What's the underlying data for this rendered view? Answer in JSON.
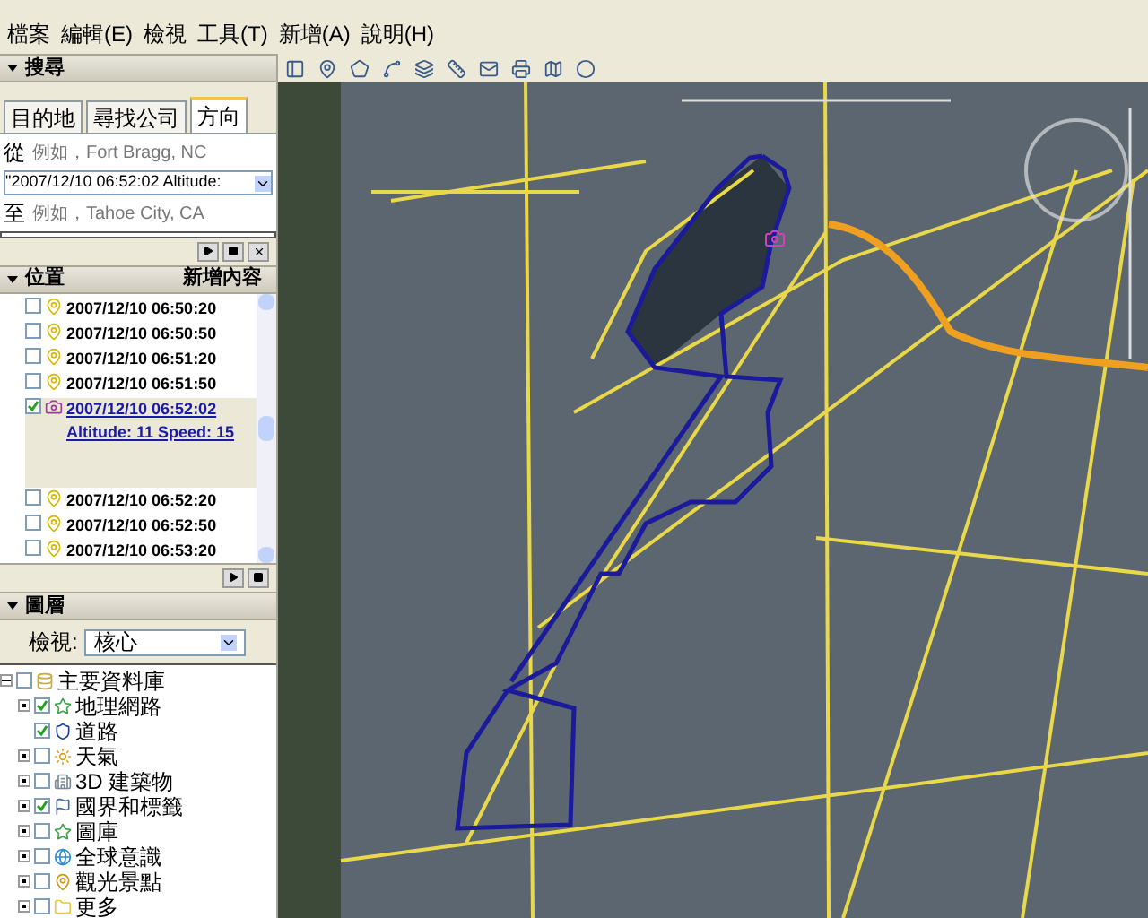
{
  "menu": [
    "檔案",
    "編輯(E)",
    "檢視",
    "工具(T)",
    "新增(A)",
    "說明(H)"
  ],
  "search": {
    "title": "搜尋",
    "tabs": [
      {
        "label": "目的地",
        "selected": false
      },
      {
        "label": "尋找公司",
        "selected": false
      },
      {
        "label": "方向",
        "selected": true
      }
    ],
    "from_label": "從",
    "from_placeholder": "例如，Fort Bragg, NC",
    "from_value": "\"2007/12/10 06:52:02 Altitude:",
    "to_label": "至",
    "to_placeholder": "例如，Tahoe City, CA"
  },
  "places": {
    "title": "位置",
    "add_button": "新增內容",
    "items": [
      {
        "label": "2007/12/10 06:50:20",
        "checked": false,
        "kind": "pin",
        "selected": false
      },
      {
        "label": "2007/12/10 06:50:50",
        "checked": false,
        "kind": "pin",
        "selected": false
      },
      {
        "label": "2007/12/10 06:51:20",
        "checked": false,
        "kind": "pin",
        "selected": false
      },
      {
        "label": "2007/12/10 06:51:50",
        "checked": false,
        "kind": "pin",
        "selected": false
      },
      {
        "label": "2007/12/10 06:52:02 Altitude: 11 Speed: 15",
        "checked": true,
        "kind": "camera",
        "selected": true
      },
      {
        "label": "2007/12/10 06:52:20",
        "checked": false,
        "kind": "pin",
        "selected": false
      },
      {
        "label": "2007/12/10 06:52:50",
        "checked": false,
        "kind": "pin",
        "selected": false
      },
      {
        "label": "2007/12/10 06:53:20",
        "checked": false,
        "kind": "pin",
        "selected": false
      }
    ]
  },
  "layers": {
    "title": "圖層",
    "view_label": "檢視:",
    "view_value": "核心",
    "tree": {
      "label": "主要資料庫",
      "checked": false,
      "expanded": true,
      "kind": "database",
      "children": [
        {
          "label": "地理網路",
          "checked": true,
          "expanded": false,
          "kind": "star"
        },
        {
          "label": "道路",
          "checked": true,
          "kind": "shield"
        },
        {
          "label": "天氣",
          "checked": false,
          "expanded": false,
          "kind": "sun"
        },
        {
          "label": "3D 建築物",
          "checked": false,
          "expanded": false,
          "kind": "building"
        },
        {
          "label": "國界和標籤",
          "checked": true,
          "expanded": false,
          "kind": "flag"
        },
        {
          "label": "圖庫",
          "checked": false,
          "expanded": false,
          "kind": "star"
        },
        {
          "label": "全球意識",
          "checked": false,
          "expanded": false,
          "kind": "globe"
        },
        {
          "label": "觀光景點",
          "checked": false,
          "expanded": false,
          "kind": "pin"
        },
        {
          "label": "更多",
          "checked": false,
          "expanded": false,
          "kind": "folder"
        }
      ]
    }
  }
}
